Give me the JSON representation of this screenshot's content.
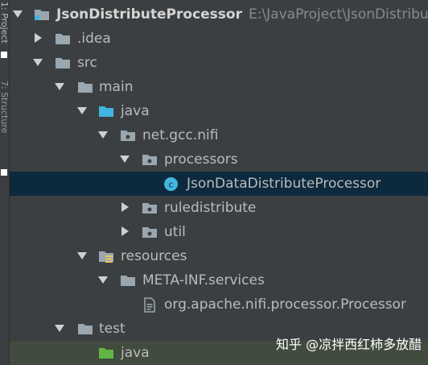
{
  "sidebar": {
    "tab_label": "1: Project",
    "tab_label_2": "7: Structure"
  },
  "tree": {
    "root": {
      "name": "JsonDistributeProcessor",
      "path": "E:\\JavaProject\\JsonDistribut"
    },
    "idea": "idea",
    "idea_prefix": ".",
    "src": "src",
    "main": "main",
    "main_java": "java",
    "package": "net.gcc.nifi",
    "processors": "processors",
    "processor_class": "JsonDataDistributeProcessor",
    "class_icon_letter": "c",
    "ruledistribute": "ruledistribute",
    "util": "util",
    "resources": "resources",
    "meta_inf": "META-INF.services",
    "service_file": "org.apache.nifi.processor.Processor",
    "test": "test",
    "test_java": "java"
  },
  "watermark": "知乎 @凉拌西红柿多放醋",
  "colors": {
    "background": "#3c3f41",
    "selection": "#0d293e",
    "text": "#bbbbbb",
    "folder_gray": "#9aa7b0",
    "source_folder_blue": "#40b6e0",
    "test_folder_green": "#62b543",
    "class_icon": "#40b6e0"
  },
  "icons": {
    "root": "module-folder-icon",
    "folder": "folder-icon",
    "source_root": "source-root-folder-icon",
    "package": "package-icon",
    "class": "java-class-icon",
    "resources": "resources-folder-icon",
    "file": "text-file-icon",
    "test_root": "test-root-folder-icon"
  }
}
